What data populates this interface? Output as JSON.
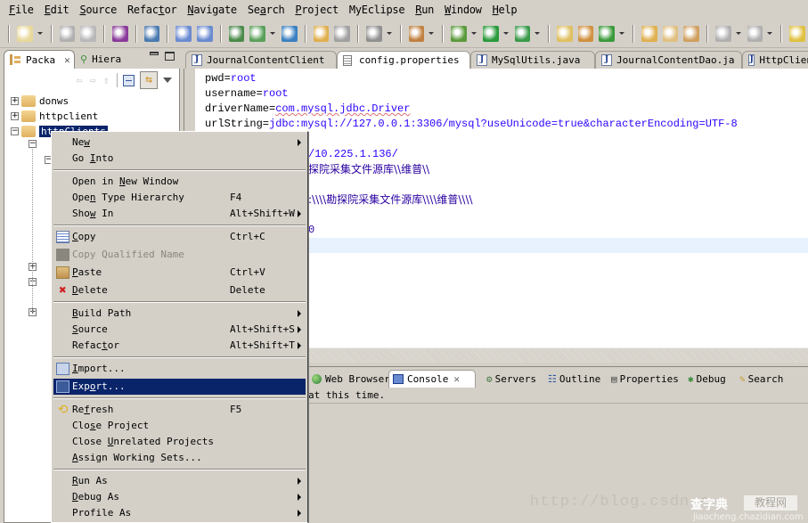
{
  "menubar": {
    "items": [
      {
        "label": "File",
        "mnemonic": "F"
      },
      {
        "label": "Edit",
        "mnemonic": "E"
      },
      {
        "label": "Source",
        "mnemonic": "S"
      },
      {
        "label": "Refactor",
        "mnemonic": "t"
      },
      {
        "label": "Navigate",
        "mnemonic": "N"
      },
      {
        "label": "Search",
        "mnemonic": "a"
      },
      {
        "label": "Project",
        "mnemonic": "P"
      },
      {
        "label": "MyEclipse",
        "mnemonic": ""
      },
      {
        "label": "Run",
        "mnemonic": "R"
      },
      {
        "label": "Window",
        "mnemonic": "W"
      },
      {
        "label": "Help",
        "mnemonic": "H"
      }
    ]
  },
  "toolbar": {
    "icons": [
      "new-wizard-icon",
      "save-icon",
      "print-icon",
      "new-ejb-project-icon",
      "web-services-icon",
      "add-deployment-icon",
      "manage-deployments-icon",
      "new-server-icon",
      "run-server-icon",
      "browser-icon",
      "open-type-icon",
      "open-task-icon",
      "screenshot-icon",
      "new-bean-icon",
      "debug-icon",
      "run-icon",
      "external-tools-icon",
      "new-java-package-icon",
      "new-java-class-icon",
      "new-class-icon",
      "open-folder-icon",
      "pencil-icon",
      "open-project-icon",
      "next-annotation-icon",
      "previous-annotation-icon",
      "back-icon"
    ]
  },
  "left_panel": {
    "tabs": [
      {
        "label": "Packa",
        "active": true,
        "icon": "package-explorer-icon"
      },
      {
        "label": "Hiera",
        "active": false,
        "icon": "hierarchy-icon"
      }
    ],
    "tree": [
      {
        "label": "donws",
        "expanded": false,
        "selected": false
      },
      {
        "label": "httpclient",
        "expanded": false,
        "selected": false
      },
      {
        "label": "httpClients",
        "expanded": true,
        "selected": true
      }
    ]
  },
  "editor": {
    "tabs": [
      {
        "label": "JournalContentClient",
        "icon": "java-file-icon",
        "active": false
      },
      {
        "label": "config.properties",
        "icon": "properties-file-icon",
        "active": true
      },
      {
        "label": "MySqlUtils.java",
        "icon": "java-file-icon",
        "active": false
      },
      {
        "label": "JournalContentDao.ja",
        "icon": "java-file-icon",
        "active": false
      },
      {
        "label": "HttpClien",
        "icon": "java-file-icon",
        "active": false
      }
    ],
    "lines": [
      {
        "key": "pwd=",
        "value": "root"
      },
      {
        "key": "username=",
        "value": "root"
      },
      {
        "key": "driverName=",
        "value": "com.mysql.jdbc.Driver"
      },
      {
        "key": "urlString=",
        "value": "jdbc:mysql://127.0.0.1:3306/mysql?useUnicode=true&characterEncoding=UTF-8"
      },
      {
        "key": "",
        "value": "/10.225.1.136/"
      },
      {
        "key": "",
        "value": "勘探院采集文件源库\\\\维普\\\\"
      },
      {
        "key": "",
        "value": ":\\\\\\\\勘探院采集文件源库\\\\\\\\维普\\\\\\\\"
      },
      {
        "key": "",
        "value": "0"
      }
    ],
    "visible_fragments": {
      "line5": "/10.225.1.136/",
      "line6": "探院采集文件源库\\\\维普\\\\",
      "line8": ":\\\\\\\\勘探院采集文件源库\\\\\\\\维普\\\\\\\\",
      "line10": "0"
    }
  },
  "bottom_panel": {
    "tabs": [
      {
        "label": "Web Browser",
        "icon": "globe-icon",
        "active": false
      },
      {
        "label": "Console",
        "icon": "console-icon",
        "active": true
      },
      {
        "label": "Servers",
        "icon": "servers-icon",
        "active": false
      },
      {
        "label": "Outline",
        "icon": "outline-icon",
        "active": false
      },
      {
        "label": "Properties",
        "icon": "properties-icon",
        "active": false
      },
      {
        "label": "Debug",
        "icon": "debug-icon",
        "active": false
      },
      {
        "label": "Search",
        "icon": "search-icon",
        "active": false
      }
    ],
    "console_text": "at this time."
  },
  "context_menu": {
    "items": [
      {
        "label": "New",
        "mn": "w",
        "shortcut": "",
        "submenu": true
      },
      {
        "label": "Go Into",
        "mn": "I",
        "shortcut": "",
        "submenu": false
      },
      {
        "sep": true
      },
      {
        "label": "Open in New Window",
        "mn": "N",
        "shortcut": "",
        "submenu": false
      },
      {
        "label": "Open Type Hierarchy",
        "mn": "n",
        "shortcut": "F4",
        "submenu": false
      },
      {
        "label": "Show In",
        "mn": "w",
        "shortcut": "Alt+Shift+W",
        "submenu": true
      },
      {
        "sep": true
      },
      {
        "label": "Copy",
        "mn": "C",
        "shortcut": "Ctrl+C",
        "icon": "copy-icon"
      },
      {
        "label": "Copy Qualified Name",
        "mn": "",
        "shortcut": "",
        "disabled": true,
        "icon": "copy-qualified-name-icon"
      },
      {
        "label": "Paste",
        "mn": "P",
        "shortcut": "Ctrl+V",
        "icon": "paste-icon"
      },
      {
        "label": "Delete",
        "mn": "D",
        "shortcut": "Delete",
        "icon": "delete-icon"
      },
      {
        "sep": true
      },
      {
        "label": "Build Path",
        "mn": "B",
        "shortcut": "",
        "submenu": true
      },
      {
        "label": "Source",
        "mn": "S",
        "shortcut": "Alt+Shift+S",
        "submenu": true
      },
      {
        "label": "Refactor",
        "mn": "t",
        "shortcut": "Alt+Shift+T",
        "submenu": true
      },
      {
        "sep": true
      },
      {
        "label": "Import...",
        "mn": "I",
        "shortcut": "",
        "icon": "import-icon"
      },
      {
        "label": "Export...",
        "mn": "o",
        "shortcut": "",
        "icon": "export-icon",
        "selected": true
      },
      {
        "sep": true
      },
      {
        "label": "Refresh",
        "mn": "f",
        "shortcut": "F5",
        "icon": "refresh-icon"
      },
      {
        "label": "Close Project",
        "mn": "s",
        "shortcut": ""
      },
      {
        "label": "Close Unrelated Projects",
        "mn": "U",
        "shortcut": ""
      },
      {
        "label": "Assign Working Sets...",
        "mn": "A",
        "shortcut": ""
      },
      {
        "sep": true
      },
      {
        "label": "Run As",
        "mn": "R",
        "shortcut": "",
        "submenu": true
      },
      {
        "label": "Debug As",
        "mn": "D",
        "shortcut": "",
        "submenu": true
      },
      {
        "label": "Profile As",
        "mn": "",
        "shortcut": "",
        "submenu": true
      }
    ]
  },
  "watermark": {
    "text": "http://blog.csdn.n",
    "logo": "查字典",
    "logo_box": "教程网",
    "url": "jiaocheng.chazidian.com"
  },
  "colors": {
    "chrome": "#d4d0c8",
    "selection": "#0a246a",
    "property_value": "#2a00ff",
    "current_line": "#e8f2fe"
  }
}
